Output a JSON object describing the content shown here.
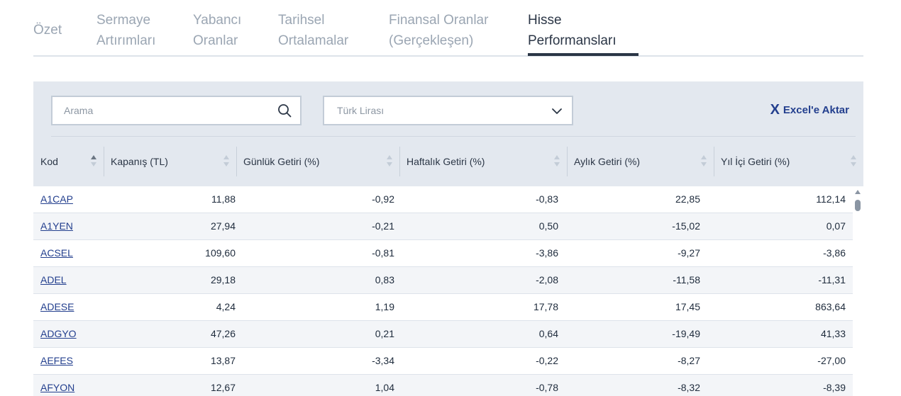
{
  "tabs": [
    {
      "line1": "Özet",
      "line2": ""
    },
    {
      "line1": "Sermaye",
      "line2": "Artırımları"
    },
    {
      "line1": "Yabancı",
      "line2": "Oranlar"
    },
    {
      "line1": "Tarihsel",
      "line2": "Ortalamalar"
    },
    {
      "line1": "Finansal Oranlar",
      "line2": "(Gerçekleşen)"
    },
    {
      "line1": "Hisse",
      "line2": "Performansları"
    }
  ],
  "active_tab": "Hisse Performansları",
  "search": {
    "placeholder": "Arama",
    "value": "",
    "icon": "search-icon"
  },
  "currency": {
    "selected": "Türk Lirası",
    "icon": "chevron-down-icon"
  },
  "export": {
    "icon_glyph": "X",
    "label": "Excel'e Aktar",
    "color": "#233f8e"
  },
  "table": {
    "headers": [
      "Kod",
      "Kapanış (TL)",
      "Günlük Getiri (%)",
      "Haftalık Getiri (%)",
      "Aylık Getiri (%)",
      "Yıl İçi Getiri (%)"
    ],
    "sorted_column": "Kod",
    "sort_direction": "ascending",
    "rows": [
      [
        "A1CAP",
        "11,88",
        "-0,92",
        "-0,83",
        "22,85",
        "112,14"
      ],
      [
        "A1YEN",
        "27,94",
        "-0,21",
        "0,50",
        "-15,02",
        "0,07"
      ],
      [
        "ACSEL",
        "109,60",
        "-0,81",
        "-3,86",
        "-9,27",
        "-3,86"
      ],
      [
        "ADEL",
        "29,18",
        "0,83",
        "-2,08",
        "-11,58",
        "-11,31"
      ],
      [
        "ADESE",
        "4,24",
        "1,19",
        "17,78",
        "17,45",
        "863,64"
      ],
      [
        "ADGYO",
        "47,26",
        "0,21",
        "0,64",
        "-19,49",
        "41,33"
      ],
      [
        "AEFES",
        "13,87",
        "-3,34",
        "-0,22",
        "-8,27",
        "-27,00"
      ],
      [
        "AFYON",
        "12,67",
        "1,04",
        "-0,78",
        "-8,32",
        "-8,39"
      ]
    ]
  },
  "colors": {
    "panel_bg": "#e3e8ef",
    "link": "#233f8e",
    "active_tab": "#2b3646",
    "inactive_tab": "#9ba6b3"
  }
}
